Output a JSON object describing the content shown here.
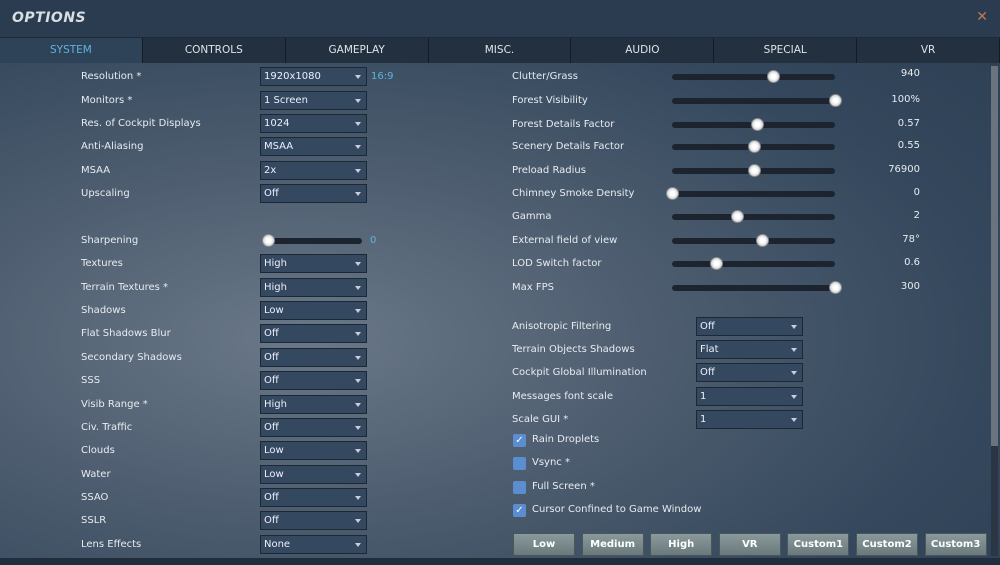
{
  "title": "OPTIONS",
  "tabs": [
    "SYSTEM",
    "CONTROLS",
    "GAMEPLAY",
    "MISC.",
    "AUDIO",
    "SPECIAL",
    "VR"
  ],
  "aspect": "16:9",
  "left": [
    {
      "label": "Resolution *",
      "value": "1920x1080"
    },
    {
      "label": "Monitors *",
      "value": "1 Screen"
    },
    {
      "label": "Res. of Cockpit Displays",
      "value": "1024"
    },
    {
      "label": "Anti-Aliasing",
      "value": "MSAA"
    },
    {
      "label": "MSAA",
      "value": "2x"
    },
    {
      "label": "Upscaling",
      "value": "Off"
    }
  ],
  "sharpening": {
    "label": "Sharpening",
    "value": "0",
    "fraction": 0.05
  },
  "left2": [
    {
      "label": "Textures",
      "value": "High"
    },
    {
      "label": "Terrain Textures *",
      "value": "High"
    },
    {
      "label": "Shadows",
      "value": "Low"
    },
    {
      "label": "Flat Shadows Blur",
      "value": "Off"
    },
    {
      "label": "Secondary Shadows",
      "value": "Off"
    },
    {
      "label": "SSS",
      "value": "Off"
    },
    {
      "label": "Visib Range *",
      "value": "High"
    },
    {
      "label": "Civ. Traffic",
      "value": "Off"
    },
    {
      "label": "Clouds",
      "value": "Low"
    },
    {
      "label": "Water",
      "value": "Low"
    },
    {
      "label": "SSAO",
      "value": "Off"
    },
    {
      "label": "SSLR",
      "value": "Off"
    },
    {
      "label": "Lens Effects",
      "value": "None"
    }
  ],
  "sliders": [
    {
      "label": "Clutter/Grass",
      "value": "940",
      "fraction": 0.62
    },
    {
      "label": "Forest Visibility",
      "value": "100%",
      "fraction": 1.0
    },
    {
      "label": "Forest Details Factor",
      "value": "0.57",
      "fraction": 0.52
    },
    {
      "label": "Scenery Details Factor",
      "value": "0.55",
      "fraction": 0.5
    },
    {
      "label": "Preload Radius",
      "value": "76900",
      "fraction": 0.5
    },
    {
      "label": "Chimney Smoke Density",
      "value": "0",
      "fraction": 0.0
    },
    {
      "label": "Gamma",
      "value": "2",
      "fraction": 0.4
    },
    {
      "label": "External field of view",
      "value": "78°",
      "fraction": 0.55
    },
    {
      "label": "LOD Switch factor",
      "value": "0.6",
      "fraction": 0.27
    },
    {
      "label": "Max FPS",
      "value": "300",
      "fraction": 1.0
    }
  ],
  "right": [
    {
      "label": "Anisotropic Filtering",
      "value": "Off"
    },
    {
      "label": "Terrain Objects Shadows",
      "value": "Flat"
    },
    {
      "label": "Cockpit Global Illumination",
      "value": "Off"
    },
    {
      "label": "Messages font scale",
      "value": "1"
    },
    {
      "label": "Scale GUI *",
      "value": "1"
    }
  ],
  "checks": [
    {
      "label": "Rain Droplets",
      "checked": true
    },
    {
      "label": "Vsync *",
      "checked": false
    },
    {
      "label": "Full Screen *",
      "checked": false
    },
    {
      "label": "Cursor Confined to Game Window",
      "checked": true
    }
  ],
  "presets": [
    "Low",
    "Medium",
    "High",
    "VR",
    "Custom1",
    "Custom2",
    "Custom3"
  ]
}
